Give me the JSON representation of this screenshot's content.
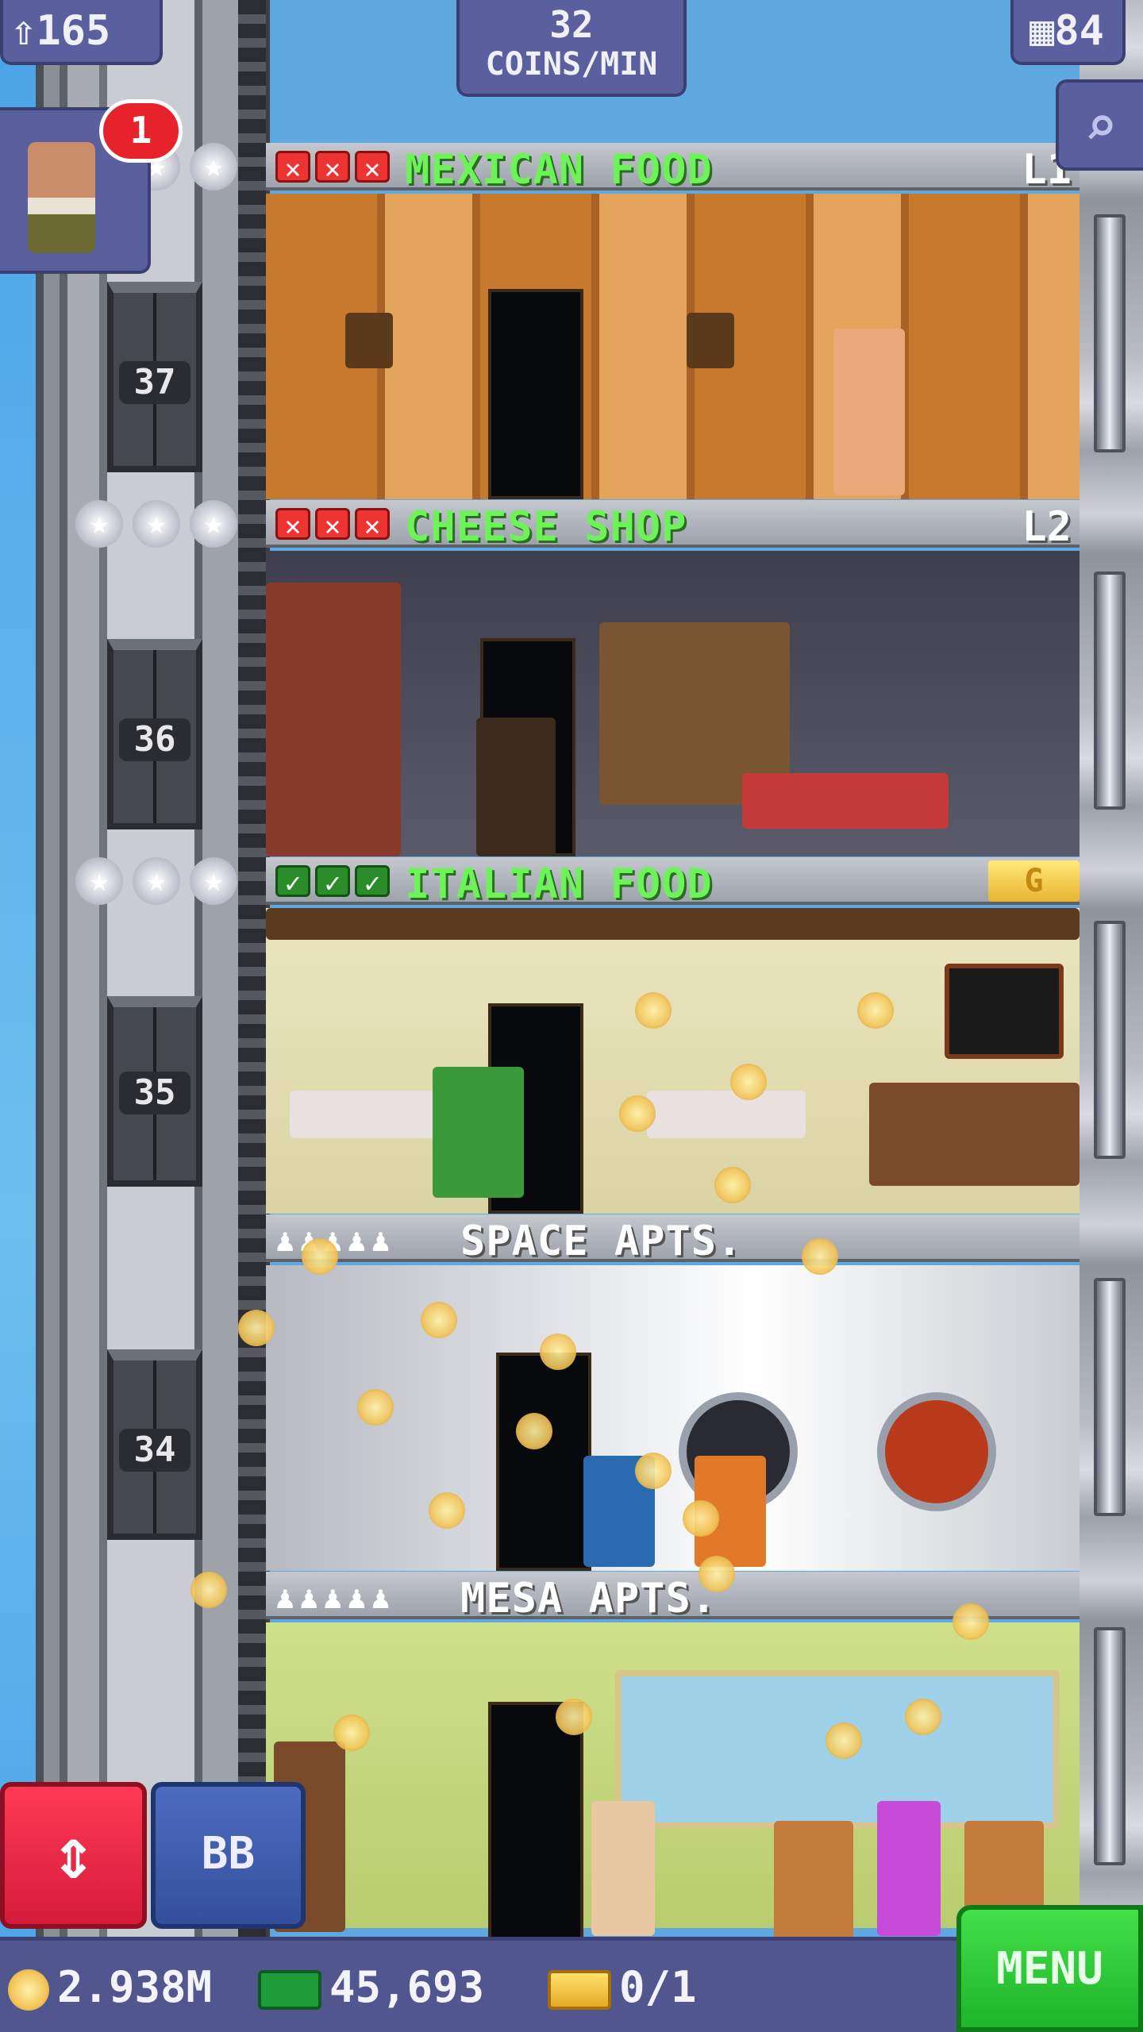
{
  "hud": {
    "population": "165",
    "rate_value": "32",
    "rate_unit": "COINS/MIN",
    "floors": "84",
    "pop_icon": "person-up-icon",
    "floor_icon": "building-icon",
    "zoom_icon": "magnifier-icon"
  },
  "visitor": {
    "notification_count": "1"
  },
  "shaft_floors": [
    {
      "number": "37"
    },
    {
      "number": "36"
    },
    {
      "number": "35"
    },
    {
      "number": "34"
    }
  ],
  "floors": [
    {
      "name": "MEXICAN FOOD",
      "level": "L1",
      "status": [
        "x",
        "x",
        "x"
      ]
    },
    {
      "name": "CHEESE SHOP",
      "level": "L2",
      "status": [
        "x",
        "x",
        "x"
      ]
    },
    {
      "name": "ITALIAN FOOD",
      "level": "G",
      "status": [
        "ok",
        "ok",
        "ok"
      ]
    },
    {
      "name": "SPACE APTS.",
      "residents_icon": "residents-icon"
    },
    {
      "name": "MESA APTS.",
      "residents_icon": "residents-icon"
    }
  ],
  "controls": {
    "elevator_label": "⇕",
    "bb_label": "BB",
    "menu_label": "MENU"
  },
  "stats": {
    "coins": "2.938M",
    "bux": "45,693",
    "vip": "0/1"
  },
  "colors": {
    "store_name": "#6ef25a",
    "hud_panel": "#5a5f9e",
    "menu_button": "#1fb42a",
    "elevator_button": "#d41c3a",
    "bb_button": "#34509c",
    "x_mark": "#e33333"
  }
}
